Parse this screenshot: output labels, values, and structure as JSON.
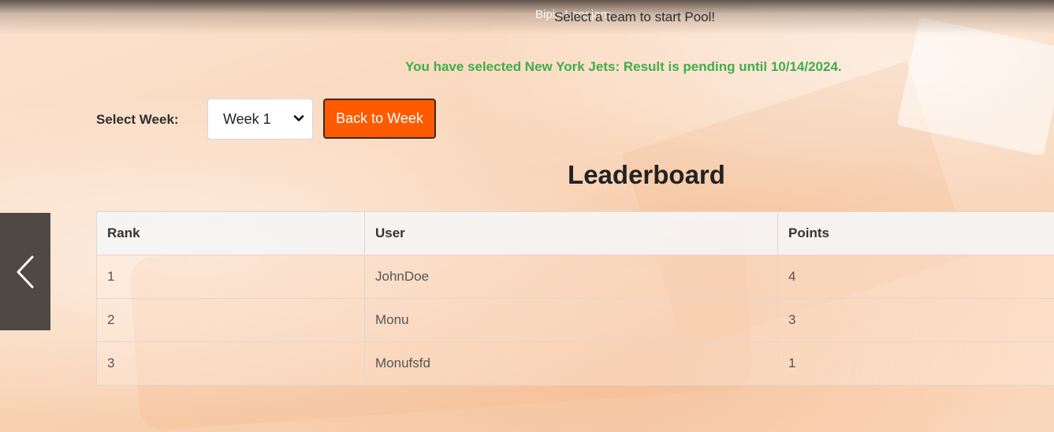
{
  "header": {
    "user_name": "Bipin Longjam",
    "select_message": "Select a team to start Pool!"
  },
  "status": {
    "pending_message": "You have selected New York Jets: Result is pending until 10/14/2024.",
    "color": "#3fae49"
  },
  "week_selector": {
    "label": "Select Week:",
    "selected": "Week 1"
  },
  "back_button": {
    "label": "Back to Week",
    "color": "#ff5a00"
  },
  "leaderboard": {
    "title": "Leaderboard",
    "columns": [
      "Rank",
      "User",
      "Points"
    ],
    "rows": [
      [
        "1",
        "JohnDoe",
        "4"
      ],
      [
        "2",
        "Monu",
        "3"
      ],
      [
        "3",
        "Monufsfd",
        "1"
      ]
    ]
  },
  "carousel": {
    "prev_icon": "chevron-left-icon"
  }
}
